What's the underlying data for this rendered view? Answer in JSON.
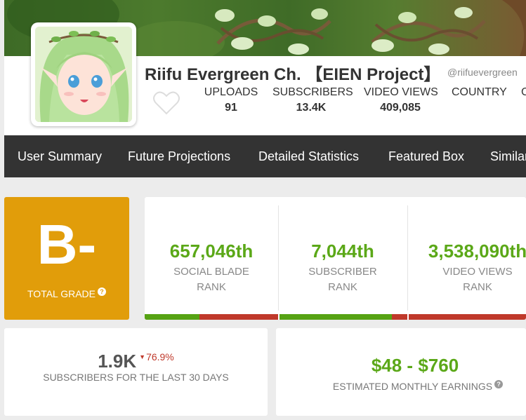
{
  "channel": {
    "name": "Riifu Evergreen Ch. 【EIEN Project】",
    "handle": "@riifuevergreen"
  },
  "stats": [
    {
      "label": "UPLOADS",
      "value": "91"
    },
    {
      "label": "SUBSCRIBERS",
      "value": "13.4K"
    },
    {
      "label": "VIDEO VIEWS",
      "value": "409,085"
    },
    {
      "label": "COUNTRY",
      "value": ""
    }
  ],
  "nav": {
    "items": [
      {
        "label": "User Summary"
      },
      {
        "label": "Future Projections"
      },
      {
        "label": "Detailed Statistics"
      },
      {
        "label": "Featured Box"
      },
      {
        "label": "Similar"
      }
    ]
  },
  "grade": {
    "letter": "B-",
    "label": "TOTAL GRADE",
    "help_icon": "question-circle-icon"
  },
  "ranks": [
    {
      "value": "657,046th",
      "label_line1": "SOCIAL BLADE",
      "label_line2": "RANK",
      "bar_fill_fraction": 0.41
    },
    {
      "value": "7,044th",
      "label_line1": "SUBSCRIBER",
      "label_line2": "RANK",
      "bar_fill_fraction": 0.88
    },
    {
      "value": "3,538,090th",
      "label_line1": "VIDEO VIEWS",
      "label_line2": "RANK",
      "bar_fill_fraction": 0.0
    }
  ],
  "subscribers_30d": {
    "value": "1.9K",
    "change": "76.9%",
    "change_icon": "triangle-down-icon",
    "label": "SUBSCRIBERS FOR THE LAST 30 DAYS"
  },
  "earnings": {
    "range": "$48  -  $760",
    "label": "ESTIMATED MONTHLY EARNINGS",
    "help_icon": "question-circle-icon"
  },
  "colors": {
    "grade_bg": "#e19d0a",
    "rank_green": "#5ba818",
    "bar_green": "#56a314",
    "bar_red": "#c0392b",
    "nav_bg": "#333333"
  }
}
